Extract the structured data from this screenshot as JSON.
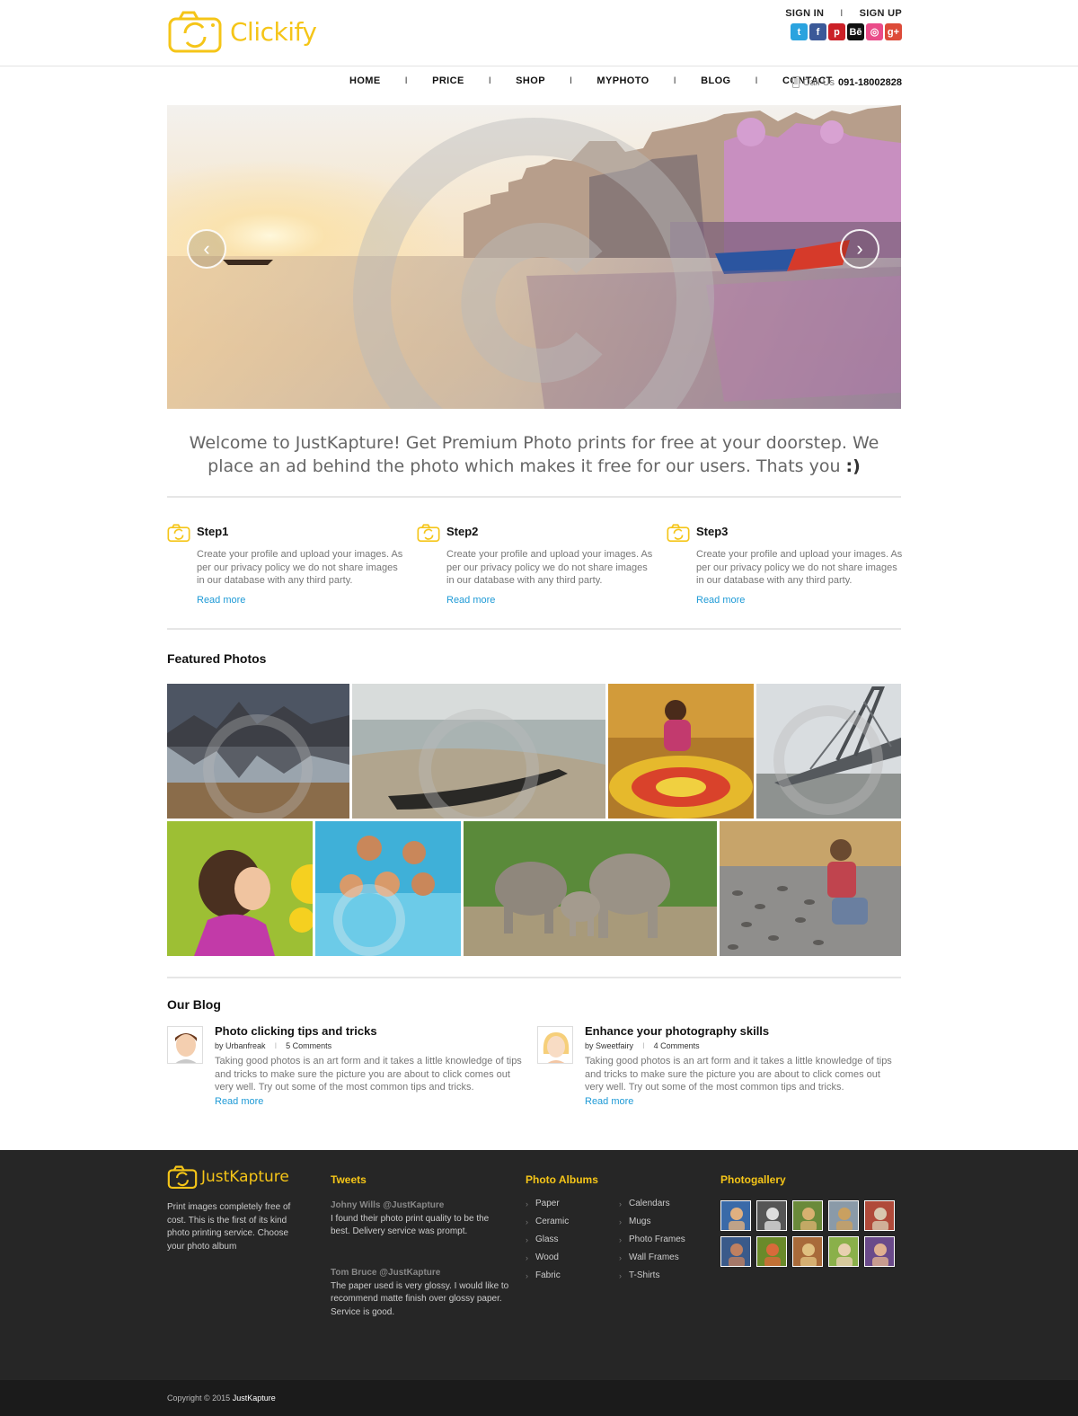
{
  "header": {
    "brand": "Clickify",
    "sign_in": "SIGN IN",
    "sign_up": "SIGN UP",
    "separator": "I",
    "social": [
      {
        "icon": "twitter-icon",
        "glyph": "t",
        "color": "#2aa3df"
      },
      {
        "icon": "facebook-icon",
        "glyph": "f",
        "color": "#3b5998"
      },
      {
        "icon": "pinterest-icon",
        "glyph": "p",
        "color": "#cb2027"
      },
      {
        "icon": "behance-icon",
        "glyph": "Bē",
        "color": "#111111"
      },
      {
        "icon": "dribbble-icon",
        "glyph": "◎",
        "color": "#ea4c89"
      },
      {
        "icon": "googleplus-icon",
        "glyph": "g+",
        "color": "#dd4b39"
      }
    ]
  },
  "nav": {
    "items": [
      "HOME",
      "PRICE",
      "SHOP",
      "MYPHOTO",
      "BLOG",
      "CONTACT"
    ],
    "separator": "I",
    "call_label": "Call Us",
    "call_number": "091-18002828"
  },
  "hero": {
    "prev_icon": "chevron-left-icon",
    "next_icon": "chevron-right-icon"
  },
  "welcome": {
    "line": "Welcome to JustKapture! Get Premium Photo prints  for free at your doorstep. We place an ad behind the photo which makes it free for our users. Thats you",
    "emoticon": ":)"
  },
  "steps": [
    {
      "title": "Step1",
      "body": "Create your profile and upload your images. As per our privacy policy we do not share images in our database with any third party.",
      "link": "Read more"
    },
    {
      "title": "Step2",
      "body": "Create your profile and upload your images. As per our privacy policy we do not share images in our database with any third party.",
      "link": "Read more"
    },
    {
      "title": "Step3",
      "body": "Create your profile and upload your images. As per our privacy policy we do not share images in our database with any third party.",
      "link": "Read more"
    }
  ],
  "featured": {
    "title": "Featured Photos"
  },
  "blog": {
    "title": "Our Blog",
    "posts": [
      {
        "title": "Photo clicking tips and tricks",
        "by_label": "by",
        "author": "Urbanfreak",
        "comments": "5 Comments",
        "body": "Taking good photos is an art form and it takes a little knowledge of tips and tricks to make sure the picture you are about to click comes out very well. Try out some of the most common tips and tricks.",
        "link": "Read more"
      },
      {
        "title": "Enhance your photography skills",
        "by_label": "by",
        "author": "Sweetfairy",
        "comments": "4 Comments",
        "body": "Taking good photos is an art form and it takes a little knowledge of tips and tricks to make sure the picture you are about to click comes out very well. Try out some of the most common tips and tricks.",
        "link": "Read more"
      }
    ]
  },
  "footer": {
    "brand": "JustKapture",
    "description": "Print images completely free of cost. This is the first of its kind photo printing service. Choose your photo album",
    "tweets_title": "Tweets",
    "tweets": [
      {
        "who": "Johny Wills @JustKapture",
        "text": "I found their photo print quality to be the best. Delivery service was prompt."
      },
      {
        "who": "Tom Bruce @JustKapture",
        "text": "The paper used is very glossy. I would like to recommend matte finish over glossy paper. Service is good."
      }
    ],
    "albums_title": "Photo Albums",
    "albums_col1": [
      "Paper",
      "Ceramic",
      "Glass",
      "Wood",
      "Fabric"
    ],
    "albums_col2": [
      "Calendars",
      "Mugs",
      "Photo Frames",
      "Wall Frames",
      "T-Shirts"
    ],
    "gallery_title": "Photogallery",
    "copyright": "Copyright © 2015",
    "copyright_brand": "JustKapture"
  },
  "colors": {
    "brand_yellow": "#f5c518",
    "link_blue": "#1e9ad6",
    "footer_bg": "#262626"
  }
}
